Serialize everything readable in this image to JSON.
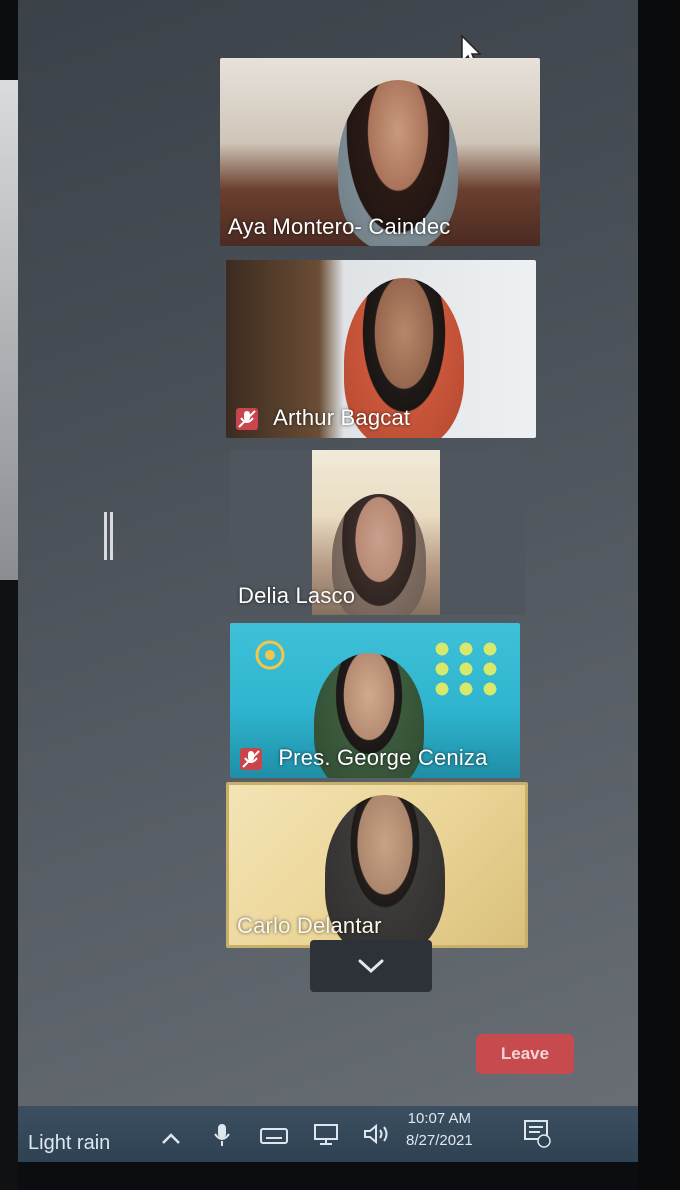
{
  "participants": [
    {
      "name": "Aya Montero- Caindec",
      "muted": false
    },
    {
      "name": "Arthur Bagcat",
      "muted": true
    },
    {
      "name": "Delia Lasco",
      "muted": false
    },
    {
      "name": "Pres. George Ceniza",
      "muted": true
    },
    {
      "name": "Carlo Delantar",
      "muted": false
    }
  ],
  "controls": {
    "leave_label": "Leave",
    "more_icon": "chevron-down-icon"
  },
  "taskbar": {
    "weather": "Light rain",
    "time": "10:07 AM",
    "date": "8/27/2021"
  },
  "colors": {
    "leave": "#c74a4e",
    "taskbar": "#2f4254"
  }
}
